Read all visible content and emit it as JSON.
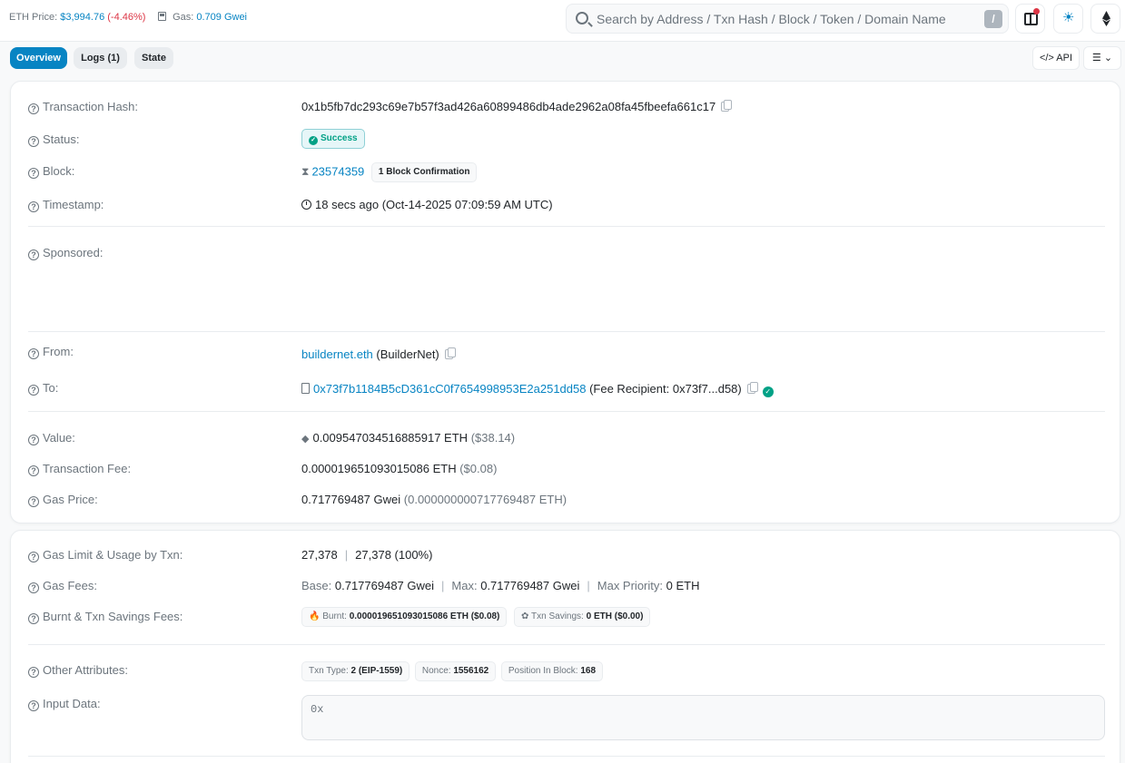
{
  "topbar": {
    "eth_price_label": "ETH Price:",
    "eth_price_value": "$3,994.76",
    "eth_price_change": "(-4.46%)",
    "gas_label": "Gas:",
    "gas_value": "0.709 Gwei",
    "search_placeholder": "Search by Address / Txn Hash / Block / Token / Domain Name",
    "search_shortcut": "/"
  },
  "tabs": [
    {
      "label": "Overview",
      "active": true
    },
    {
      "label": "Logs (1)",
      "active": false
    },
    {
      "label": "State",
      "active": false
    }
  ],
  "toolbar": {
    "api_label": "</> API",
    "more_label": "☰ ⌄"
  },
  "details": {
    "tx_hash_label": "Transaction Hash:",
    "tx_hash": "0x1b5fb7dc293c69e7b57f3ad426a60899486db4ade2962a08fa45fbeefa661c17",
    "status_label": "Status:",
    "status": "Success",
    "block_label": "Block:",
    "block_number": "23574359",
    "block_confirmations": "1 Block Confirmation",
    "timestamp_label": "Timestamp:",
    "timestamp": "18 secs ago (Oct-14-2025 07:09:59 AM UTC)",
    "sponsored_label": "Sponsored:",
    "from_label": "From:",
    "from_name": "buildernet.eth",
    "from_tag": "(BuilderNet)",
    "to_label": "To:",
    "to_address": "0x73f7b1184B5cD361cC0f7654998953E2a251dd58",
    "to_tag": "(Fee Recipient: 0x73f7...d58)",
    "value_label": "Value:",
    "value_eth": "0.009547034516885917 ETH",
    "value_usd": "($38.14)",
    "fee_label": "Transaction Fee:",
    "fee_eth": "0.000019651093015086 ETH",
    "fee_usd": "($0.08)",
    "gas_price_label": "Gas Price:",
    "gas_price": "0.717769487 Gwei",
    "gas_price_eth": "(0.000000000717769487 ETH)"
  },
  "more": {
    "gas_limit_label": "Gas Limit & Usage by Txn:",
    "gas_limit": "27,378",
    "gas_usage": "27,378 (100%)",
    "gas_fees_label": "Gas Fees:",
    "base_label": "Base:",
    "base_value": "0.717769487 Gwei",
    "max_label": "Max:",
    "max_value": "0.717769487 Gwei",
    "max_priority_label": "Max Priority:",
    "max_priority_value": "0 ETH",
    "burnt_label": "Burnt & Txn Savings Fees:",
    "burnt_key": "Burnt:",
    "burnt_value": "0.000019651093015086 ETH ($0.08)",
    "savings_key": "Txn Savings:",
    "savings_value": "0 ETH ($0.00)",
    "other_label": "Other Attributes:",
    "txn_type_key": "Txn Type:",
    "txn_type_value": "2 (EIP-1559)",
    "nonce_key": "Nonce:",
    "nonce_value": "1556162",
    "position_key": "Position In Block:",
    "position_value": "168",
    "input_label": "Input Data:",
    "input_value": "0x"
  },
  "colors": {
    "link": "#0784c3",
    "success": "#00a186",
    "negative": "#dc3545"
  }
}
